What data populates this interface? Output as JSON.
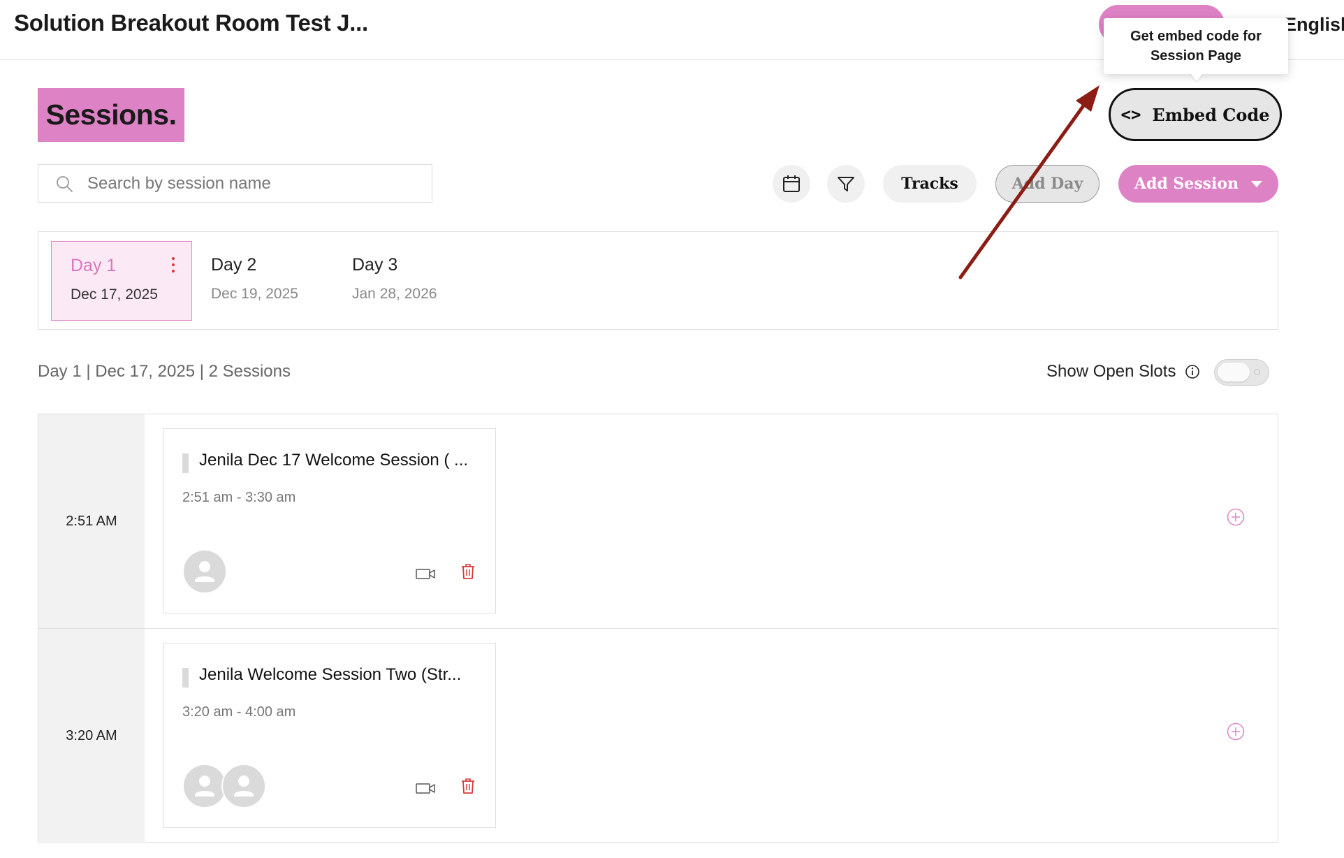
{
  "header": {
    "event_title": "Solution Breakout Room Test J...",
    "language": "English"
  },
  "tooltip": {
    "text": "Get embed code for Session Page"
  },
  "page": {
    "title": "Sessions.",
    "embed_code_label": "Embed Code"
  },
  "search": {
    "placeholder": "Search by session name",
    "value": ""
  },
  "toolbar": {
    "tracks_label": "Tracks",
    "add_day_label": "Add Day",
    "add_session_label": "Add Session"
  },
  "days": [
    {
      "name": "Day 1",
      "date": "Dec 17, 2025",
      "selected": true
    },
    {
      "name": "Day 2",
      "date": "Dec 19, 2025",
      "selected": false
    },
    {
      "name": "Day 3",
      "date": "Jan 28, 2026",
      "selected": false
    }
  ],
  "summary": {
    "text": "Day 1 | Dec 17, 2025 | 2 Sessions",
    "open_slots_label": "Show Open Slots",
    "open_slots_enabled": false
  },
  "slots": [
    {
      "time": "2:51 AM",
      "session": {
        "name": "Jenila Dec 17 Welcome Session ( ...",
        "time_range": "2:51 am - 3:30 am",
        "speakers": 1
      }
    },
    {
      "time": "3:20 AM",
      "session": {
        "name": "Jenila Welcome Session Two (Str...",
        "time_range": "3:20 am - 4:00 am",
        "speakers": 2
      }
    }
  ],
  "colors": {
    "brand_pink": "#de82c6",
    "delete_red": "#d63a3a",
    "annotation_arrow": "#8b1d14"
  }
}
